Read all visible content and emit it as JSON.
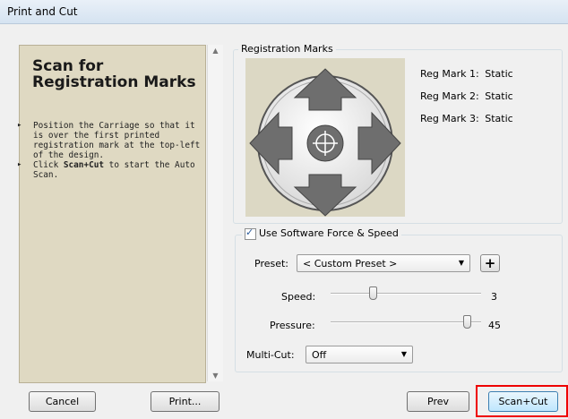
{
  "window": {
    "title": "Print and Cut"
  },
  "left_panel": {
    "title": "Scan for Registration Marks",
    "instructions": [
      {
        "parts": [
          {
            "text": "Position the Carriage so that it is over the first printed registration mark at the top-left of the design.",
            "bold": false
          }
        ]
      },
      {
        "parts": [
          {
            "text": "Click ",
            "bold": false
          },
          {
            "text": "Scan+Cut",
            "bold": true
          },
          {
            "text": " to start the Auto Scan.",
            "bold": false
          }
        ]
      }
    ]
  },
  "registration": {
    "legend": "Registration Marks",
    "marks": [
      {
        "label": "Reg Mark 1:",
        "value": "Static"
      },
      {
        "label": "Reg Mark 2:",
        "value": "Static"
      },
      {
        "label": "Reg Mark 3:",
        "value": "Static"
      }
    ]
  },
  "software": {
    "checkbox_label": "Use Software Force  & Speed",
    "checked": true,
    "preset_label": "Preset:",
    "preset_value": "< Custom Preset >",
    "speed_label": "Speed:",
    "speed_value": "3",
    "speed_level": 0.27,
    "pressure_label": "Pressure:",
    "pressure_value": "45",
    "pressure_level": 0.93,
    "multicut_label": "Multi-Cut:",
    "multicut_value": "Off"
  },
  "buttons": {
    "cancel": "Cancel",
    "print": "Print...",
    "prev": "Prev",
    "scan_cut": "Scan+Cut"
  },
  "colors": {
    "panel_bg": "#dfd9c2",
    "highlight": "#e00000"
  }
}
